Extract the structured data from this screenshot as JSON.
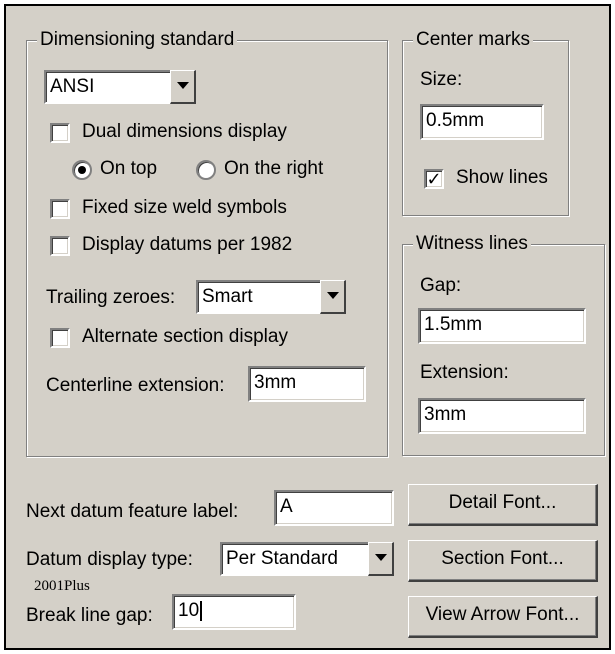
{
  "dimensioning": {
    "title": "Dimensioning standard",
    "standard": "ANSI",
    "dual_dimensions_label": "Dual dimensions display",
    "dual_dimensions_checked": false,
    "on_top_label": "On top",
    "on_top_selected": true,
    "on_right_label": "On the right",
    "on_right_selected": false,
    "fixed_weld_label": "Fixed size weld symbols",
    "fixed_weld_checked": false,
    "datums_1982_label": "Display datums per 1982",
    "datums_1982_checked": false,
    "trailing_zeroes_label": "Trailing zeroes:",
    "trailing_zeroes_value": "Smart",
    "alt_section_label": "Alternate section display",
    "alt_section_checked": false,
    "centerline_label": "Centerline extension:",
    "centerline_value": "3mm"
  },
  "center_marks": {
    "title": "Center marks",
    "size_label": "Size:",
    "size_value": "0.5mm",
    "show_lines_label": "Show lines",
    "show_lines_checked": true
  },
  "witness_lines": {
    "title": "Witness lines",
    "gap_label": "Gap:",
    "gap_value": "1.5mm",
    "extension_label": "Extension:",
    "extension_value": "3mm"
  },
  "bottom": {
    "next_datum_label": "Next datum feature label:",
    "next_datum_value": "A",
    "datum_display_label": "Datum display type:",
    "datum_display_value": "Per Standard",
    "break_gap_label": "Break line gap:",
    "break_gap_value": "10"
  },
  "buttons": {
    "detail_font": "Detail Font...",
    "section_font": "Section Font...",
    "view_arrow_font": "View Arrow Font..."
  },
  "watermark": "2001Plus"
}
